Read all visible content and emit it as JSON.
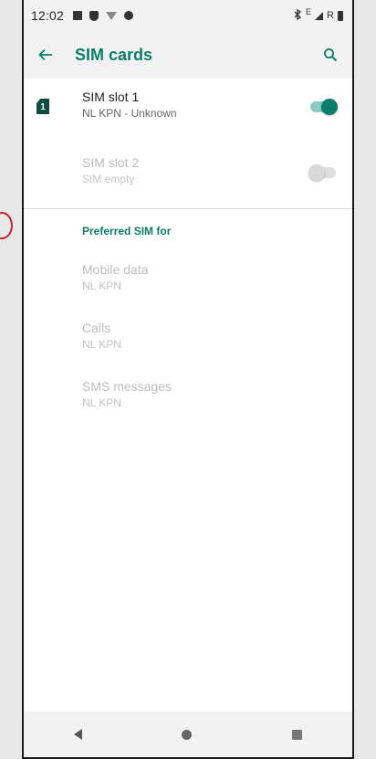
{
  "status_bar": {
    "time": "12:02",
    "right_text": "E",
    "roaming": "R"
  },
  "toolbar": {
    "title": "SIM cards"
  },
  "sim_slots": [
    {
      "label": "SIM slot 1",
      "subtitle": "NL KPN - Unknown",
      "enabled": true,
      "icon_text": "1"
    },
    {
      "label": "SIM slot 2",
      "subtitle": "SIM empty",
      "enabled": false
    }
  ],
  "preferred": {
    "header": "Preferred SIM for",
    "items": [
      {
        "label": "Mobile data",
        "value": "NL KPN"
      },
      {
        "label": "Calls",
        "value": "NL KPN"
      },
      {
        "label": "SMS messages",
        "value": "NL KPN"
      }
    ]
  },
  "colors": {
    "accent": "#0a7d6b",
    "toggle_track_on": "#8ccbc2"
  },
  "icons": {
    "back": "arrow-left-icon",
    "search": "search-icon",
    "sim": "sim-card-icon"
  }
}
